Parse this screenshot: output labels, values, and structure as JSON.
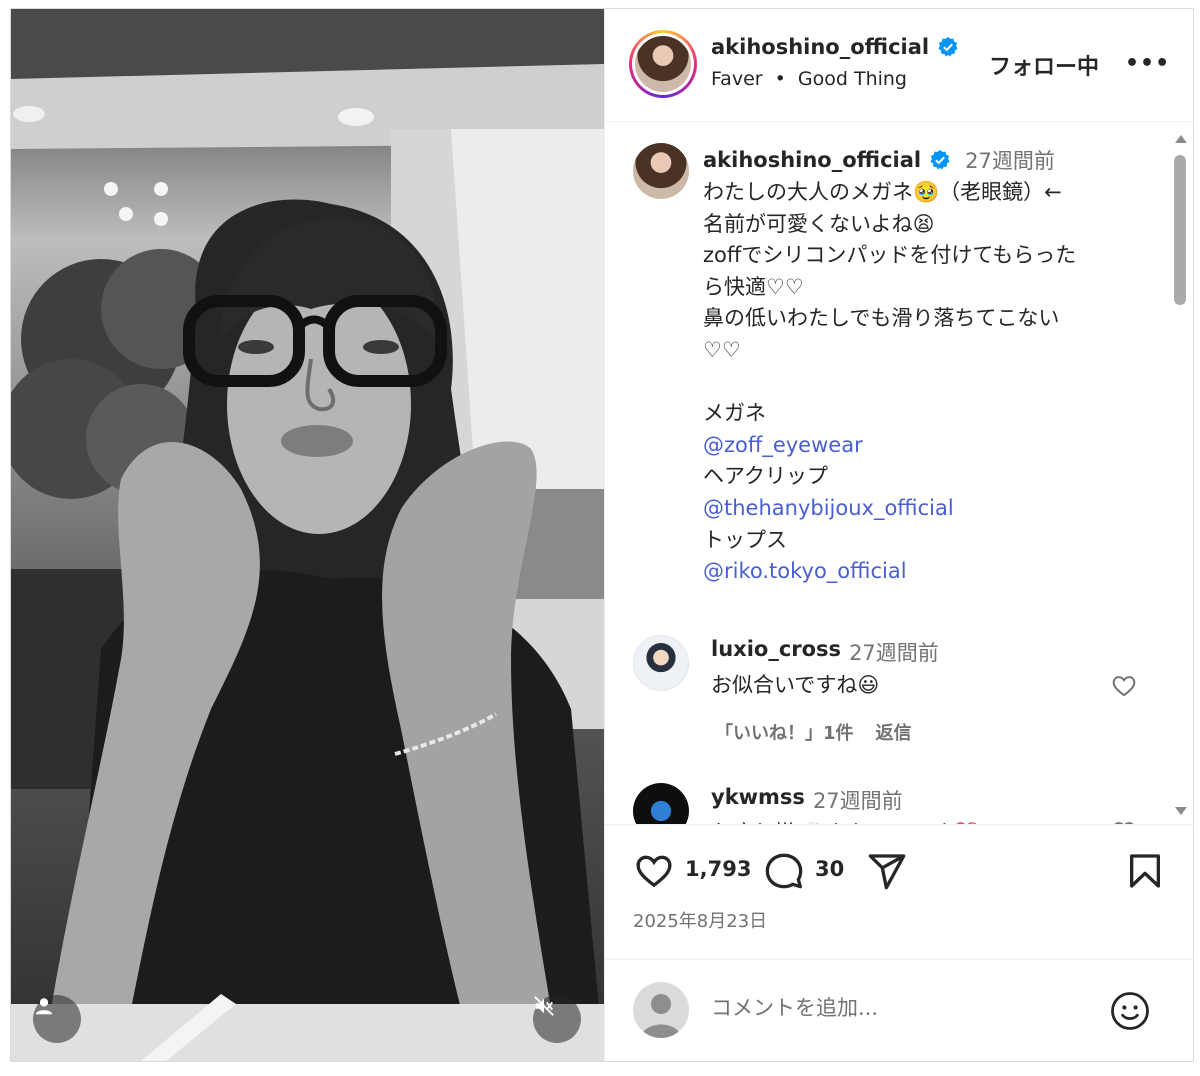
{
  "header": {
    "username": "akihoshino_official",
    "subtitle_artist": "Faver",
    "subtitle_separator": "•",
    "subtitle_track": "Good Thing",
    "follow_label": "フォロー中",
    "more_label": "•••"
  },
  "caption": {
    "username": "akihoshino_official",
    "time": "27週間前",
    "lines": [
      {
        "text": "わたしの大人のメガネ🥹（老眼鏡）←"
      },
      {
        "text": "名前が可愛くないよね😫"
      },
      {
        "text": "zoffでシリコンパッドを付けてもらった"
      },
      {
        "text": "ら快適♡♡"
      },
      {
        "text": "鼻の低いわたしでも滑り落ちてこない"
      },
      {
        "text": "♡♡"
      },
      {
        "text": ""
      },
      {
        "text": "メガネ"
      },
      {
        "text": "@zoff_eyewear",
        "link": true
      },
      {
        "text": "ヘアクリップ"
      },
      {
        "text": "@thehanybijoux_official",
        "link": true
      },
      {
        "text": "トップス"
      },
      {
        "text": "@riko.tokyo_official",
        "link": true
      }
    ]
  },
  "comments": [
    {
      "username": "luxio_cross",
      "time": "27週間前",
      "text": "お似合いですね😃",
      "likes_label": "「いいね！」1件",
      "reply_label": "返信"
    },
    {
      "username": "ykwmss",
      "time": "27週間前",
      "text": "お疲れ様🥂 かわいいです💖"
    }
  ],
  "actions": {
    "likes": "1,793",
    "comments": "30"
  },
  "post_date": "2025年8月23日",
  "compose": {
    "placeholder": "コメントを追加..."
  },
  "colors": {
    "link": "#4a5ed0",
    "verified": "#0095f6",
    "muted_text": "#737373"
  },
  "icons": [
    "user-tag-icon",
    "mute-icon",
    "verified-badge-icon",
    "heart-icon",
    "comment-icon",
    "share-icon",
    "bookmark-icon",
    "emoji-icon"
  ]
}
